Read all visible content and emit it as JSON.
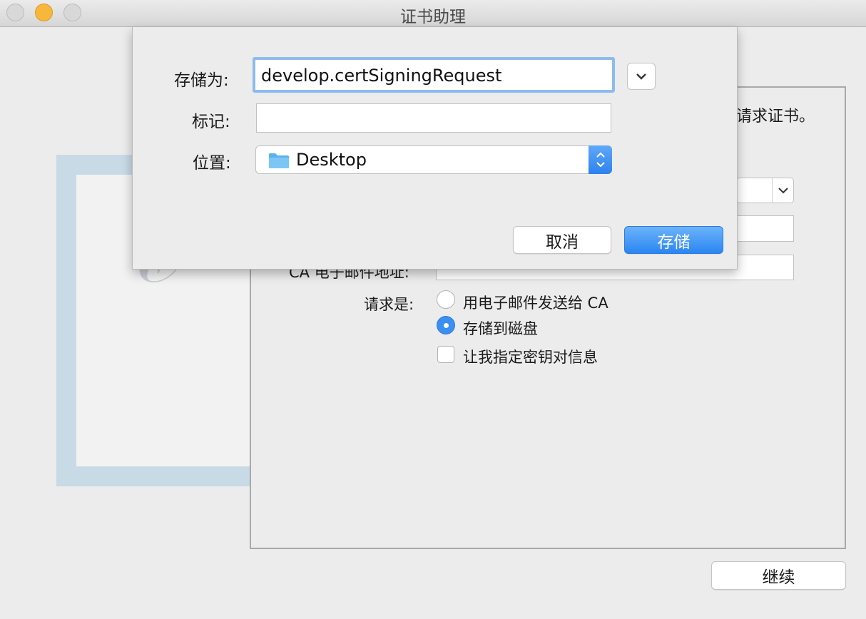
{
  "window": {
    "title": "证书助理"
  },
  "background": {
    "request_text_tail": "请求证书。",
    "ca_email_label": "CA 电子邮件地址:",
    "request_is_label": "请求是:",
    "options": [
      {
        "label": "用电子邮件发送给 CA",
        "selected": false
      },
      {
        "label": "存储到磁盘",
        "selected": true
      }
    ],
    "checkbox_label": "让我指定密钥对信息",
    "checkbox_checked": false,
    "continue_button": "继续"
  },
  "save_sheet": {
    "save_as_label": "存储为:",
    "filename": "develop.certSigningRequest",
    "tags_label": "标记:",
    "tags_value": "",
    "location_label": "位置:",
    "location_value": "Desktop",
    "cancel_button": "取消",
    "save_button": "存储"
  },
  "colors": {
    "accent": "#3a8ff1",
    "minimize": "#f6b73a"
  },
  "icons": [
    "close-icon",
    "minimize-icon",
    "zoom-icon",
    "chevron-down-icon",
    "folder-icon",
    "up-down-chevron-icon"
  ]
}
